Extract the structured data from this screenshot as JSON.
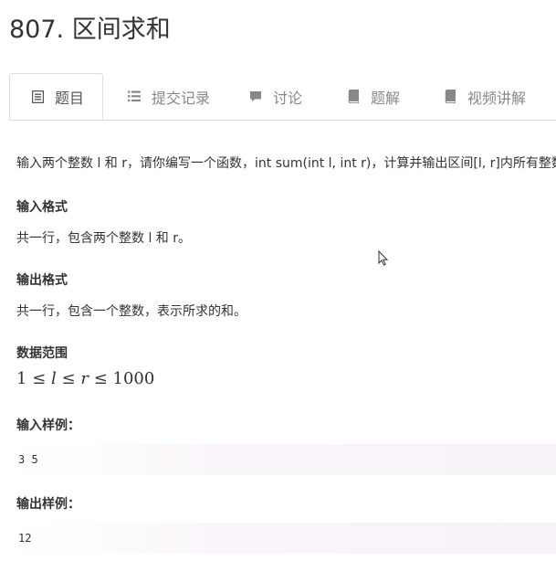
{
  "problem": {
    "title": "807. 区间求和"
  },
  "tabs": [
    {
      "label": "题目",
      "icon": "doc-icon",
      "active": true
    },
    {
      "label": "提交记录",
      "icon": "list-icon",
      "active": false
    },
    {
      "label": "讨论",
      "icon": "comment-icon",
      "active": false
    },
    {
      "label": "题解",
      "icon": "book-icon",
      "active": false
    },
    {
      "label": "视频讲解",
      "icon": "book-icon",
      "active": false
    }
  ],
  "statement": {
    "description": "输入两个整数 l 和 r，请你编写一个函数，int sum(int l, int r)，计算并输出区间[l, r]内所有整数的和。",
    "input_format_heading": "输入格式",
    "input_format_text": "共一行，包含两个整数 l 和 r。",
    "output_format_heading": "输出格式",
    "output_format_text": "共一行，包含一个整数，表示所求的和。",
    "range_heading": "数据范围",
    "range_formula": {
      "lower": "1",
      "var1": "l",
      "var2": "r",
      "upper": "1000",
      "leq": "≤"
    },
    "sample_input_heading": "输入样例：",
    "sample_input": "3 5",
    "sample_output_heading": "输出样例：",
    "sample_output": "12"
  },
  "colors": {
    "text": "#333333",
    "tab_inactive": "#888888",
    "border": "#dddddd",
    "sample_bg": "#f7f2f8"
  }
}
